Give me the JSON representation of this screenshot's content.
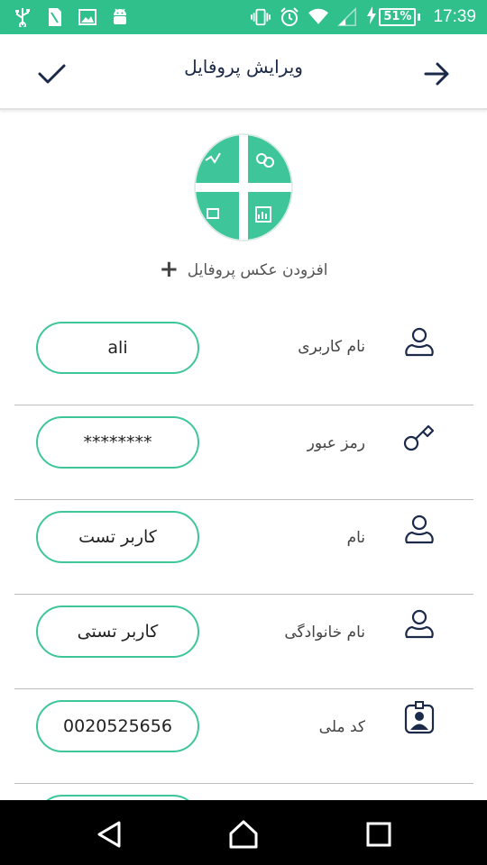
{
  "status_bar": {
    "battery": "51%",
    "time": "17:39",
    "left_icons": [
      "usb-icon",
      "sim-icon",
      "image-icon",
      "android-icon"
    ],
    "right_icons": [
      "vibrate-icon",
      "alarm-icon",
      "wifi-icon",
      "signal-icon",
      "charging-icon"
    ]
  },
  "toolbar": {
    "title": "ویرایش پروفایل",
    "confirm_icon": "check-icon",
    "back_icon": "arrow-right-icon"
  },
  "profile": {
    "add_photo_label": "افزودن عکس پروفایل",
    "add_photo_plus": "+"
  },
  "fields": [
    {
      "label": "نام کاربری",
      "value": "ali",
      "icon": "user-icon"
    },
    {
      "label": "رمز عبور",
      "value": "********",
      "icon": "key-icon"
    },
    {
      "label": "نام",
      "value": "کاربر تست",
      "icon": "user-icon"
    },
    {
      "label": "نام خانوادگی",
      "value": "کاربر تستی",
      "icon": "user-icon"
    },
    {
      "label": "کد ملی",
      "value": "0020525656",
      "icon": "id-card-icon"
    }
  ],
  "colors": {
    "accent": "#2fc08c",
    "pill_border": "#3ec69a",
    "title": "#1c2a4a"
  },
  "nav_bar": {
    "icons": [
      "back-triangle-icon",
      "home-icon",
      "recents-icon"
    ]
  }
}
